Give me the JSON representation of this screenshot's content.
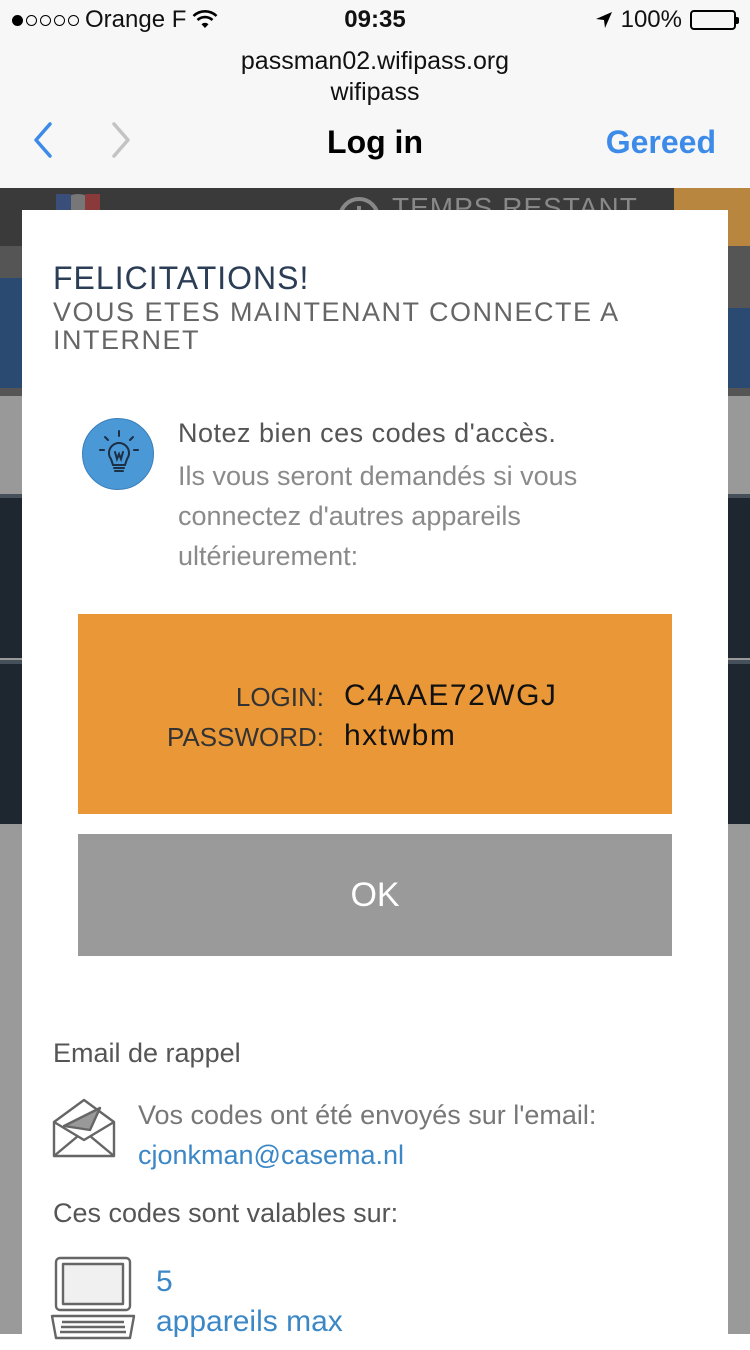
{
  "status_bar": {
    "carrier": "Orange F",
    "time": "09:35",
    "battery": "100%",
    "icons": [
      "signal-dots-icon",
      "wifi-icon",
      "location-arrow-icon",
      "battery-icon"
    ]
  },
  "browser": {
    "url_line1": "passman02.wifipass.org",
    "url_line2": "wifipass",
    "title": "Log in",
    "done_label": "Gereed",
    "accent_color": "#3d8be8"
  },
  "background_page": {
    "timer_label": "TEMPS RESTANT"
  },
  "modal": {
    "title": "FELICITATIONS!",
    "subtitle": "VOUS ETES MAINTENANT CONNECTE A INTERNET",
    "note_heading": "Notez bien ces codes d'accès.",
    "note_body": "Ils vous seront demandés si vous connectez d'autres appareils ultérieurement:",
    "credentials": {
      "login_label": "LOGIN:",
      "login_value": "C4AAE72WGJ",
      "password_label": "PASSWORD:",
      "password_value": "hxtwbm",
      "box_color": "#ea9837"
    },
    "ok_label": "OK",
    "email_section_label": "Email de rappel",
    "email_sent_text": "Vos codes ont été envoyés sur l'email:",
    "email_address": "cjonkman@casema.nl",
    "validity_label": "Ces codes sont valables sur:",
    "devices_count": "5",
    "devices_label": "appareils max"
  }
}
